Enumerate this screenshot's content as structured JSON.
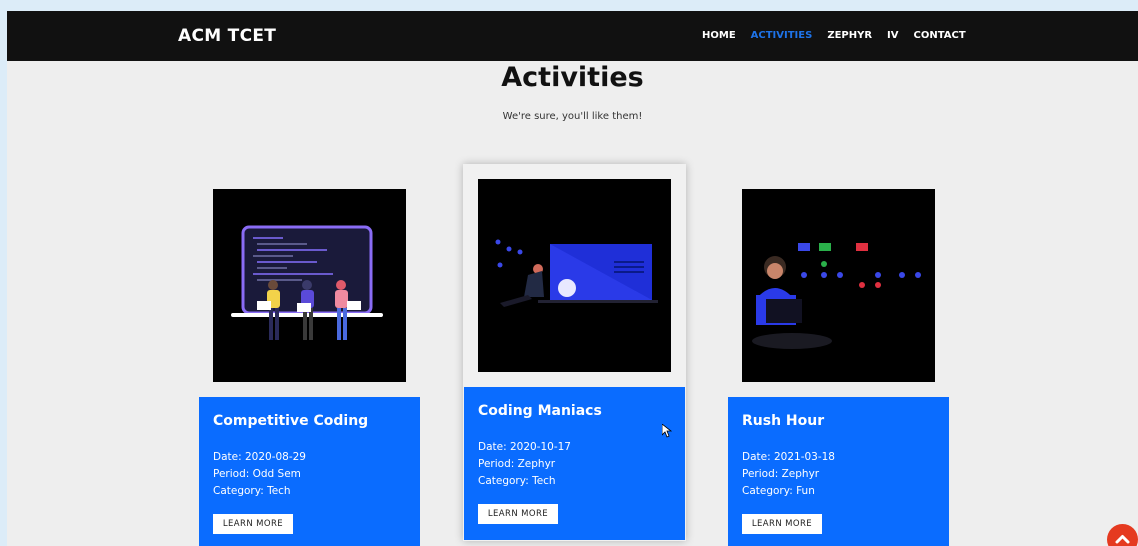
{
  "navbar": {
    "brand": "ACM TCET",
    "links": [
      {
        "label": "HOME",
        "active": false
      },
      {
        "label": "ACTIVITIES",
        "active": true
      },
      {
        "label": "ZEPHYR",
        "active": false
      },
      {
        "label": "IV",
        "active": false
      },
      {
        "label": "CONTACT",
        "active": false
      }
    ]
  },
  "section": {
    "title": "Activities",
    "subtitle": "We're sure, you'll like them!"
  },
  "cards": [
    {
      "title": "Competitive Coding",
      "date": "Date: 2020-08-29",
      "period": "Period: Odd Sem",
      "category": "Category: Tech",
      "button": "LEARN MORE",
      "illustration": "laptop-coders-illustration"
    },
    {
      "title": "Coding Maniacs",
      "date": "Date: 2020-10-17",
      "period": "Period: Zephyr",
      "category": "Category: Tech",
      "button": "LEARN MORE",
      "illustration": "presentation-screen-illustration"
    },
    {
      "title": "Rush Hour",
      "date": "Date: 2021-03-18",
      "period": "Period: Zephyr",
      "category": "Category: Fun",
      "button": "LEARN MORE",
      "illustration": "person-with-laptop-illustration"
    }
  ],
  "colors": {
    "navbar": "#111111",
    "accent": "#0a6cff",
    "active_link": "#1e73e8",
    "scroll_button": "#e53a20"
  },
  "icons": {
    "scroll_top": "chevron-up-icon"
  }
}
